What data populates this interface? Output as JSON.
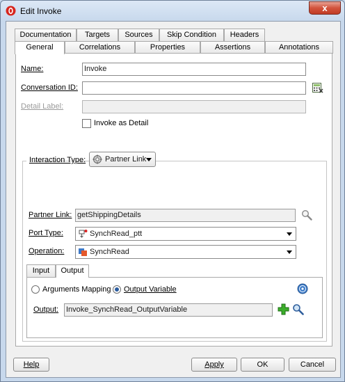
{
  "window": {
    "title": "Edit Invoke",
    "close_glyph": "x",
    "accent_close": "#c94a33"
  },
  "tabs": {
    "row1": [
      {
        "label": "Documentation"
      },
      {
        "label": "Targets"
      },
      {
        "label": "Sources"
      },
      {
        "label": "Skip Condition"
      },
      {
        "label": "Headers"
      }
    ],
    "row2": [
      {
        "label": "General",
        "active": true
      },
      {
        "label": "Correlations"
      },
      {
        "label": "Properties"
      },
      {
        "label": "Assertions"
      },
      {
        "label": "Annotations"
      }
    ]
  },
  "general": {
    "name": {
      "label": "Name:",
      "value": "Invoke"
    },
    "conversation_id": {
      "label": "Conversation ID:",
      "value": ""
    },
    "detail_label": {
      "label": "Detail Label:",
      "value": ""
    },
    "invoke_as_detail": {
      "label": "Invoke as Detail",
      "checked": false
    }
  },
  "interaction": {
    "legend_label": "Interaction Type:",
    "type_value": "Partner Link",
    "partner_link": {
      "label": "Partner Link:",
      "value": "getShippingDetails"
    },
    "port_type": {
      "label": "Port Type:",
      "value": "SynchRead_ptt"
    },
    "operation": {
      "label": "Operation:",
      "value": "SynchRead"
    }
  },
  "io_tabs": [
    {
      "label": "Input"
    },
    {
      "label": "Output",
      "active": true
    }
  ],
  "output": {
    "radio_arguments": "Arguments Mapping",
    "radio_variable": "Output Variable",
    "selected": "Output Variable",
    "label": "Output:",
    "value": "Invoke_SynchRead_OutputVariable"
  },
  "buttons": {
    "help": "Help",
    "apply": "Apply",
    "ok": "OK",
    "cancel": "Cancel"
  },
  "icons": {
    "app": "oracle-logo-icon",
    "expression_builder": "expression-builder-icon",
    "search": "search-icon",
    "partner_link": "partner-link-icon",
    "port_type": "port-type-icon",
    "operation": "operation-icon",
    "help": "help-icon",
    "add": "add-icon"
  }
}
